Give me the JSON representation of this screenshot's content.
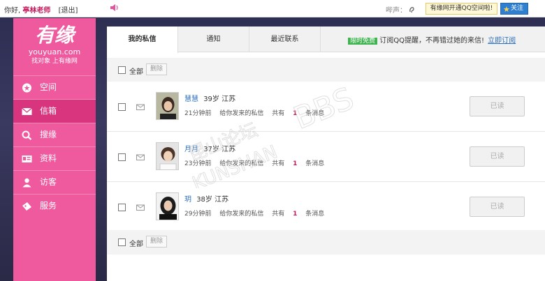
{
  "topbar": {
    "greeting": "你好,",
    "username": "亭林老师",
    "logout": "[退出]",
    "beep_label": "哔声：",
    "beep_icon": "ear-icon",
    "notice_button": "有缘网开通QQ空间啦!",
    "follow_button": "关注"
  },
  "sidebar": {
    "logo_main": "有缘",
    "logo_en": "youyuan.com",
    "logo_slogan": "找对象 上有缘网",
    "items": [
      {
        "label": "空间",
        "icon": "star-icon"
      },
      {
        "label": "信箱",
        "icon": "mail-icon"
      },
      {
        "label": "搜缘",
        "icon": "search-icon"
      },
      {
        "label": "资料",
        "icon": "id-card-icon"
      },
      {
        "label": "访客",
        "icon": "person-icon"
      },
      {
        "label": "服务",
        "icon": "ticket-icon"
      }
    ],
    "active_index": 1
  },
  "tabs": [
    {
      "label": "我的私信"
    },
    {
      "label": "通知"
    },
    {
      "label": "最近联系"
    }
  ],
  "promo": {
    "tag": "限时免费",
    "text": "订阅QQ提醒，不再错过她的来信!",
    "link": "立即订阅"
  },
  "toolbar": {
    "select_all": "全部",
    "delete": "删除"
  },
  "messages": [
    {
      "name": "慧慧",
      "age": "39岁",
      "location": "江苏",
      "time": "21分钟前",
      "summary": "给你发来的私信",
      "have": "共有",
      "count": "1",
      "unit": "条消息",
      "button": "已读"
    },
    {
      "name": "月月",
      "age": "37岁",
      "location": "江苏",
      "time": "23分钟前",
      "summary": "给你发来的私信",
      "have": "共有",
      "count": "1",
      "unit": "条消息",
      "button": "已读"
    },
    {
      "name": "玥",
      "age": "38岁",
      "location": "江苏",
      "time": "29分钟前",
      "summary": "给你发来的私信",
      "have": "共有",
      "count": "1",
      "unit": "条消息",
      "button": "已读"
    }
  ],
  "watermark": {
    "line1": "昆山论坛",
    "line2": "KUNSHAN",
    "line3": "BBS"
  },
  "colors": {
    "sidebar": "#ef5a9f",
    "sidebar_active": "#d9357f",
    "link": "#2a6ebb",
    "count": "#c2185b",
    "promo_tag": "#3fb34f"
  }
}
